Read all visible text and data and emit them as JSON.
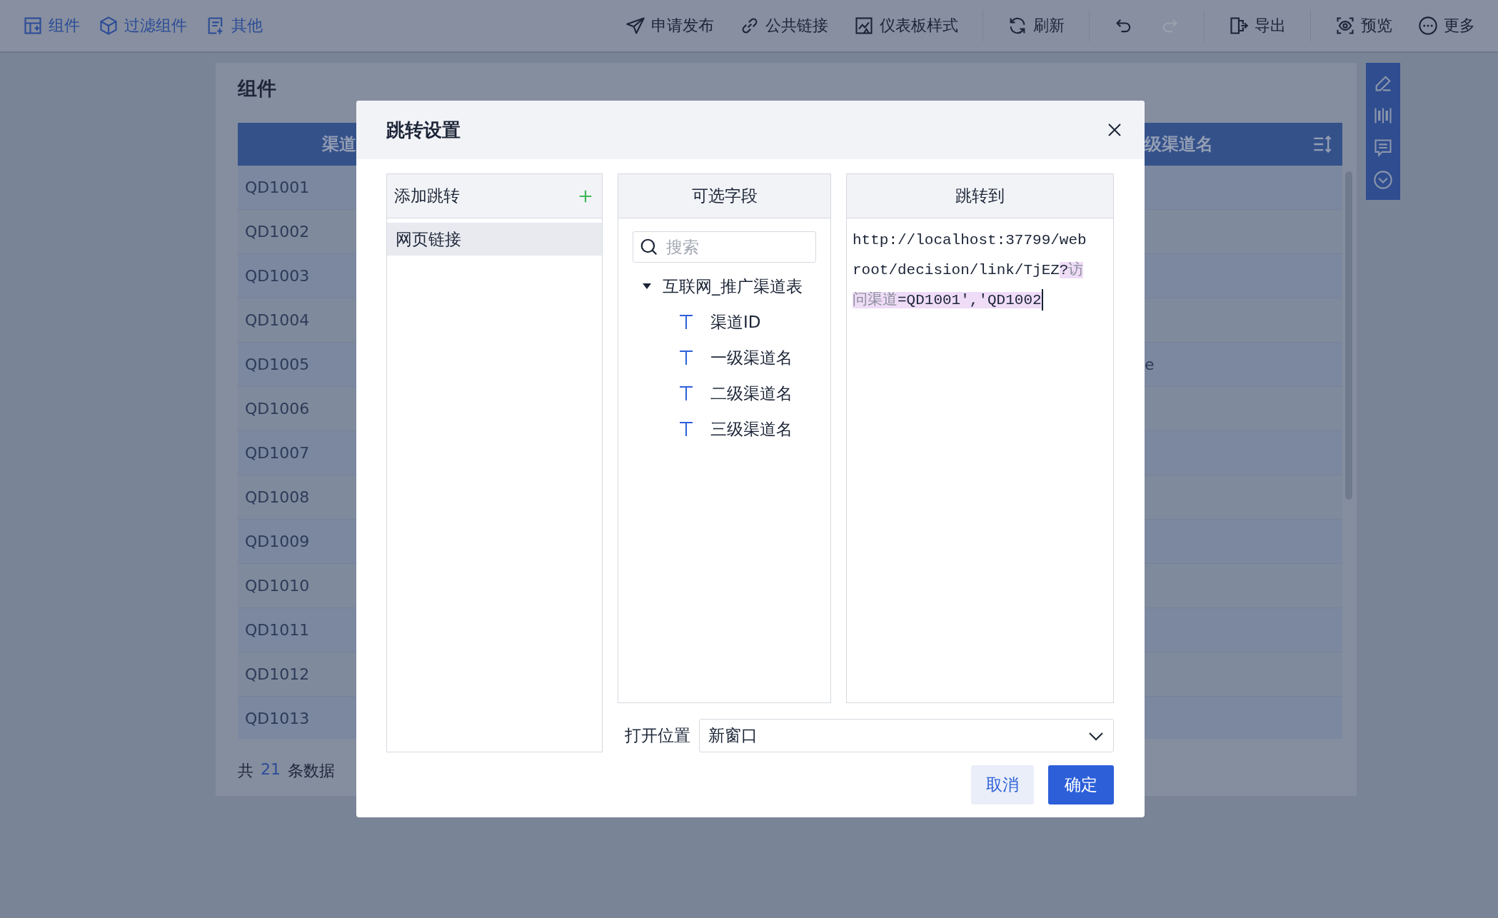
{
  "toolbar": {
    "left": [
      {
        "label": "组件"
      },
      {
        "label": "过滤组件"
      },
      {
        "label": "其他"
      }
    ],
    "right_groups": [
      [
        {
          "label": "申请发布",
          "disabled": false
        },
        {
          "label": "公共链接",
          "disabled": false
        },
        {
          "label": "仪表板样式",
          "disabled": false
        }
      ],
      [
        {
          "label": "刷新",
          "disabled": false
        }
      ],
      [
        {
          "disabled": false
        },
        {
          "disabled": true
        }
      ],
      [
        {
          "label": "导出",
          "disabled": false
        }
      ],
      [
        {
          "label": "预览",
          "disabled": false
        },
        {
          "label": "更多",
          "disabled": false
        }
      ]
    ]
  },
  "panel": {
    "title": "组件",
    "table": {
      "columns": [
        "渠道",
        "级渠道名"
      ],
      "rows": [
        [
          "QD1001"
        ],
        [
          "QD1002"
        ],
        [
          "QD1003"
        ],
        [
          "QD1004"
        ],
        [
          "QD1005",
          "e"
        ],
        [
          "QD1006"
        ],
        [
          "QD1007"
        ],
        [
          "QD1008"
        ],
        [
          "QD1009"
        ],
        [
          "QD1010"
        ],
        [
          "QD1011"
        ],
        [
          "QD1012"
        ],
        [
          "QD1013"
        ]
      ]
    },
    "footer": {
      "prefix": "共",
      "count": "21",
      "suffix": "条数据"
    }
  },
  "dialog": {
    "title": "跳转设置",
    "jumps": {
      "header": "添加跳转",
      "items": [
        {
          "label": "网页链接",
          "selected": true
        }
      ]
    },
    "fields": {
      "header": "可选字段",
      "search": {
        "placeholder": "搜索"
      },
      "tree": [
        {
          "label": "互联网_推广渠道表",
          "expanded": true,
          "children": [
            {
              "label": "渠道ID"
            },
            {
              "label": "一级渠道名"
            },
            {
              "label": "二级渠道名"
            },
            {
              "label": "三级渠道名"
            }
          ]
        }
      ]
    },
    "target": {
      "header": "跳转到",
      "focused": true,
      "segments": [
        {
          "text": "http://localhost:37799/webroot/decision/link/TjEZ",
          "highlighted": false,
          "kind": "text"
        },
        {
          "text": "?",
          "highlighted": true,
          "kind": "text"
        },
        {
          "text": "访问渠道",
          "highlighted": true,
          "kind": "field"
        },
        {
          "text": "=QD1001','QD1002",
          "highlighted": true,
          "kind": "text"
        }
      ]
    },
    "open_location": {
      "label": "打开位置",
      "value": "新窗口"
    },
    "buttons": [
      {
        "label": "取消",
        "kind": "secondary"
      },
      {
        "label": "确定",
        "kind": "primary"
      }
    ]
  }
}
